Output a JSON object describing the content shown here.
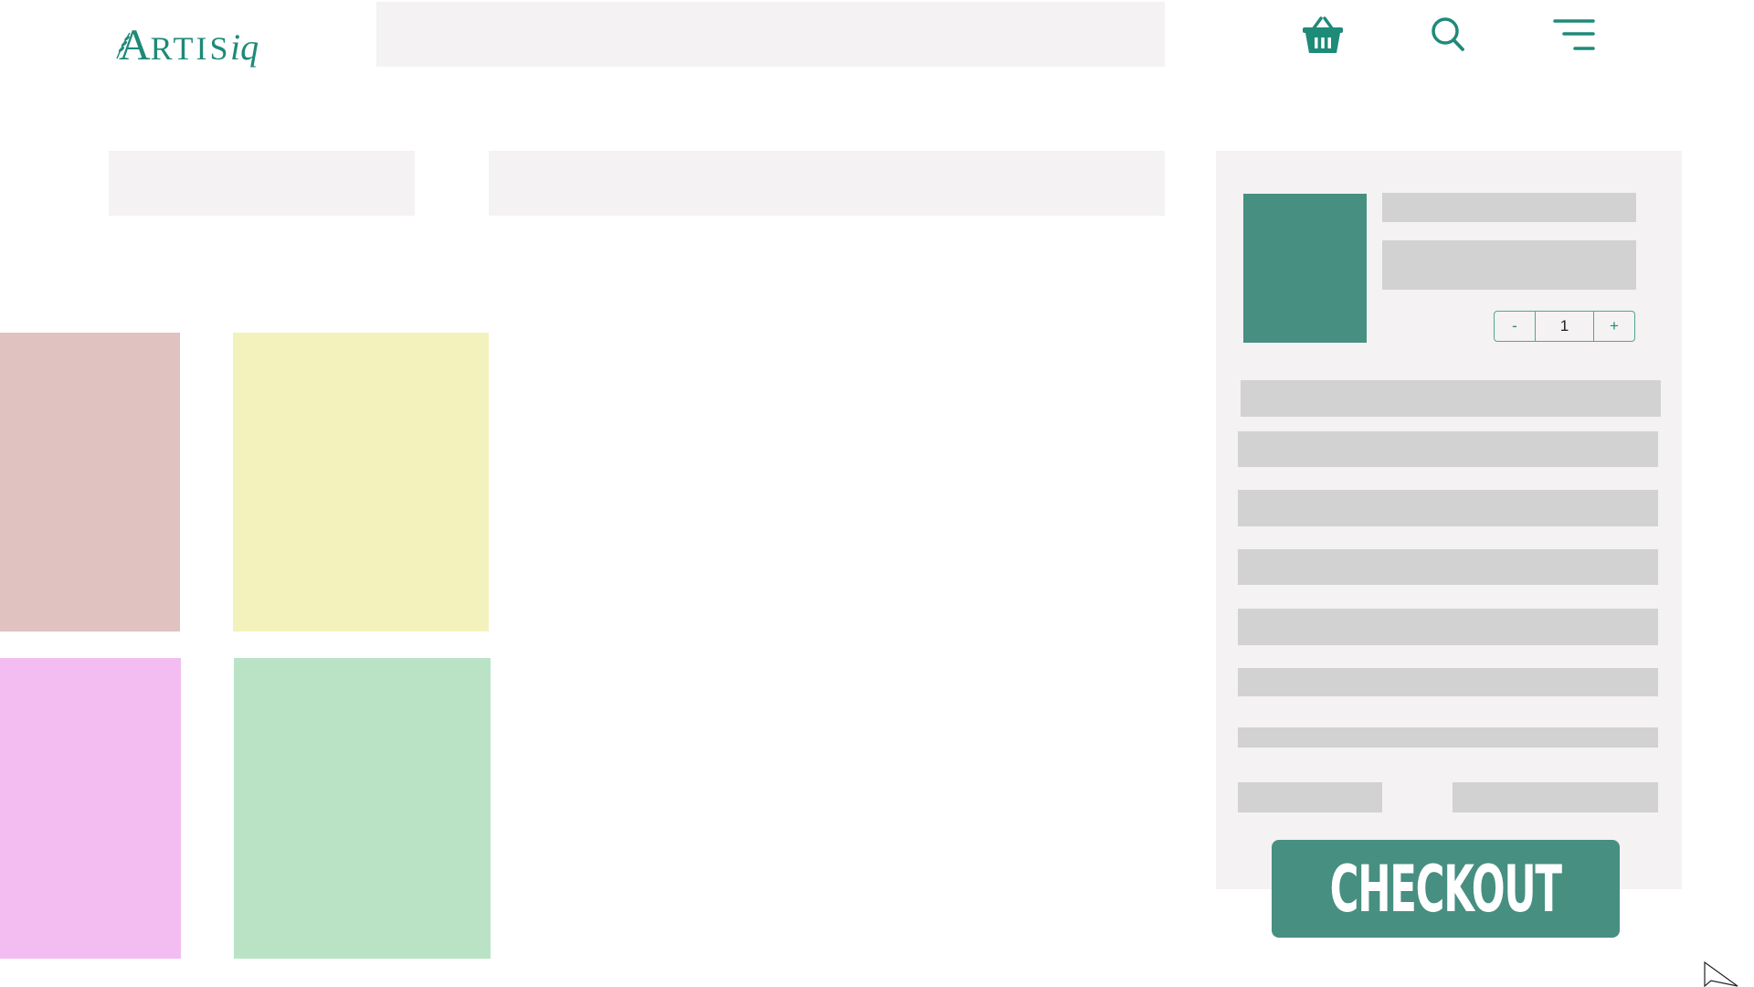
{
  "header": {
    "logo": {
      "letter_a": "A",
      "letters_rtis": "RTIS",
      "suffix": "iq",
      "brand_color": "#1e8a78"
    },
    "icons": [
      "basket-icon",
      "search-icon",
      "menu-icon"
    ],
    "icon_color": "#1e8a78"
  },
  "tiles": {
    "colors": [
      "#e0c2c0",
      "#f3f2bd",
      "#f4bdf1",
      "#bae3c6"
    ]
  },
  "cart": {
    "thumbnail_color": "#478f80",
    "quantity": {
      "minus_label": "-",
      "value": "1",
      "plus_label": "+"
    },
    "checkout_label": "CHECKOUT",
    "checkout_color": "#478f80"
  },
  "colors": {
    "placeholder_bg": "#f4f2f2",
    "skeleton": "#d2d2d2"
  }
}
